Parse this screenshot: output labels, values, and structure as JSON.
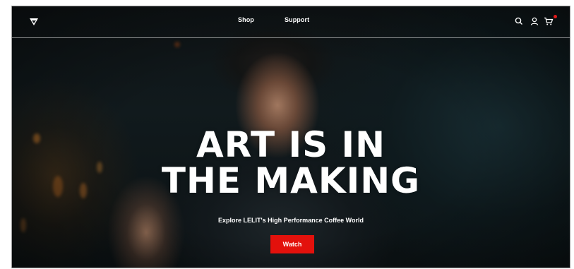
{
  "header": {
    "logo_icon": "lelit-shield-logo-icon",
    "nav": [
      {
        "label": "Shop"
      },
      {
        "label": "Support"
      }
    ],
    "icons": {
      "search": "search-icon",
      "account": "user-icon",
      "cart": "cart-icon"
    }
  },
  "hero": {
    "headline_line1": "ART IS IN",
    "headline_line2": "THE MAKING",
    "subtitle": "Explore LELIT's High Performance Coffee World",
    "cta_label": "Watch"
  },
  "colors": {
    "accent": "#e3110c",
    "cart_badge": "#e01b1b",
    "text": "#ffffff"
  }
}
